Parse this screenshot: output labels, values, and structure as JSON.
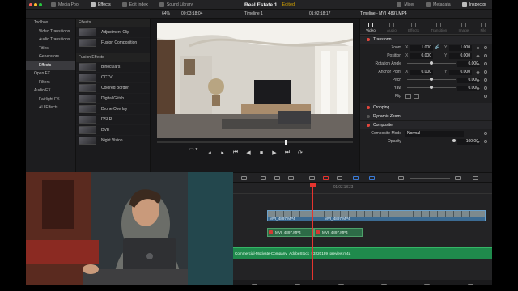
{
  "topbar": {
    "media_pool": "Media Pool",
    "effects": "Effects",
    "edit_index": "Edit Index",
    "sound_library": "Sound Library",
    "project_title": "Real Estate 1",
    "status": "Edited",
    "mixer": "Mixer",
    "metadata": "Metadata",
    "inspector": "Inspector"
  },
  "viewer_bar": {
    "zoom": "64%",
    "source_timecode": "00:03:18:04",
    "timeline_name": "Timeline 1",
    "record_timecode": "01:02:18:17",
    "inspector_title": "Timeline - MVI_4897.MP4"
  },
  "toolbox_tree": [
    {
      "label": "Toolbox",
      "level": 1,
      "selected": false
    },
    {
      "label": "Video Transitions",
      "level": 2,
      "selected": false
    },
    {
      "label": "Audio Transitions",
      "level": 2,
      "selected": false
    },
    {
      "label": "Titles",
      "level": 2,
      "selected": false
    },
    {
      "label": "Generators",
      "level": 2,
      "selected": false
    },
    {
      "label": "Effects",
      "level": 2,
      "selected": true
    },
    {
      "label": "Open FX",
      "level": 1,
      "selected": false
    },
    {
      "label": "Filters",
      "level": 2,
      "selected": false
    },
    {
      "label": "Audio FX",
      "level": 1,
      "selected": false
    },
    {
      "label": "Fairlight FX",
      "level": 2,
      "selected": false
    },
    {
      "label": "AU Effects",
      "level": 2,
      "selected": false
    }
  ],
  "effects_panel": {
    "header": "Effects",
    "items": [
      "Adjustment Clip",
      "Fusion Composition"
    ],
    "fusion_header": "Fusion Effects",
    "fusion_items": [
      "Binoculars",
      "CCTV",
      "Colored Border",
      "Digital Glitch",
      "Drone Overlay",
      "DSLR",
      "DVE",
      "Night Vision"
    ]
  },
  "inspector": {
    "tabs": [
      "Video",
      "Audio",
      "Effects",
      "Transition",
      "Image",
      "File"
    ],
    "active_tab": "Video",
    "transform_header": "Transform",
    "zoom_label": "Zoom",
    "zoom_x": "1.000",
    "zoom_y": "1.000",
    "position_label": "Position",
    "position_x": "0.000",
    "position_y": "0.000",
    "rotation_label": "Rotation Angle",
    "rotation_value": "0.000",
    "anchor_label": "Anchor Point",
    "anchor_x": "0.000",
    "anchor_y": "0.000",
    "pitch_label": "Pitch",
    "pitch_value": "0.000",
    "yaw_label": "Yaw",
    "yaw_value": "0.000",
    "flip_label": "Flip",
    "cropping_header": "Cropping",
    "dynamic_zoom_header": "Dynamic Zoom",
    "composite_header": "Composite",
    "composite_mode_label": "Composite Mode",
    "composite_mode_value": "Normal",
    "opacity_label": "Opacity",
    "opacity_value": "100.00",
    "axis_x": "X",
    "axis_y": "Y"
  },
  "timeline": {
    "ruler_timecode": "01:02:18:23",
    "video_clips": [
      "MVI_4897.MP4",
      "MVI_4897.MP4"
    ],
    "audio_clips": [
      "MVI_4897.MP4",
      "MVI_4897.MP4"
    ],
    "music_clip": "Commercial-Motivate-Company_AdobeStock_53220199_preview.m4a"
  },
  "colors": {
    "accent_red": "#e5342f",
    "video_clip": "#3c6b93",
    "audio_clip": "#2d6b47",
    "music_clip": "#1f8a4c",
    "edited": "#d6a300"
  }
}
